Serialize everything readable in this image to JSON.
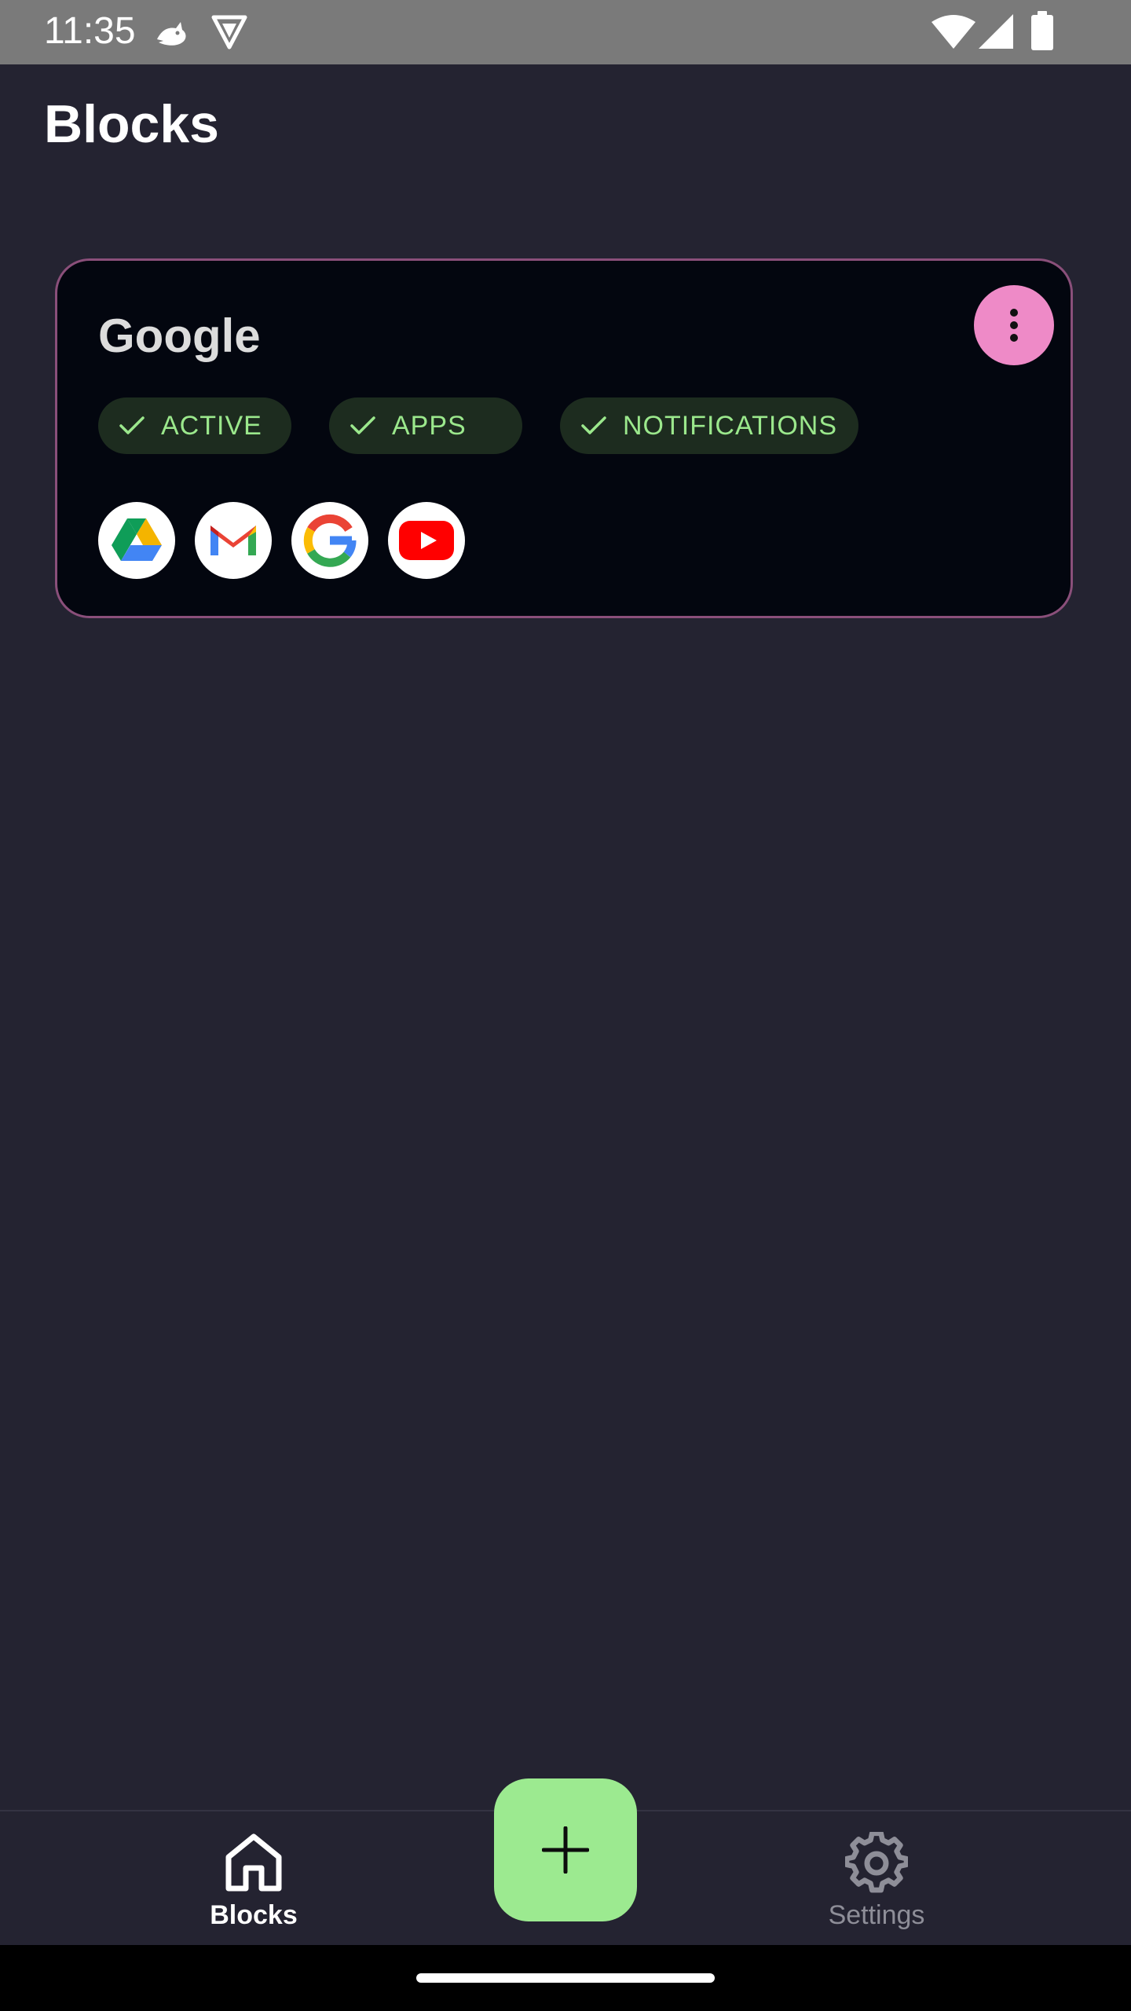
{
  "status_bar": {
    "time": "11:35",
    "left_icons": [
      "bird-notification-icon",
      "vpn-shield-icon"
    ],
    "right_icons": [
      "wifi-icon",
      "cell-signal-icon",
      "battery-icon"
    ]
  },
  "header": {
    "title": "Blocks"
  },
  "block_card": {
    "title": "Google",
    "menu_icon": "more-vert-icon",
    "chips": [
      {
        "label": "ACTIVE",
        "icon": "check-icon"
      },
      {
        "label": "APPS",
        "icon": "check-icon"
      },
      {
        "label": "NOTIFICATIONS",
        "icon": "check-icon"
      }
    ],
    "apps": [
      "google-drive-icon",
      "gmail-icon",
      "google-icon",
      "youtube-icon"
    ]
  },
  "bottom_nav": {
    "items": [
      {
        "label": "Blocks",
        "icon": "home-icon",
        "selected": true
      },
      {
        "label": "Settings",
        "icon": "gear-icon",
        "selected": false
      }
    ],
    "fab_icon": "plus-icon"
  },
  "colors": {
    "background": "#242331",
    "card": "#03060f",
    "card_border": "#8a4f7a",
    "menu_button": "#ee8ac7",
    "chip_bg": "#1d2c1f",
    "chip_text": "#9be88c",
    "fab": "#9cea90",
    "nav_selected": "#ffffff",
    "nav_unselected": "#8e8e98"
  }
}
